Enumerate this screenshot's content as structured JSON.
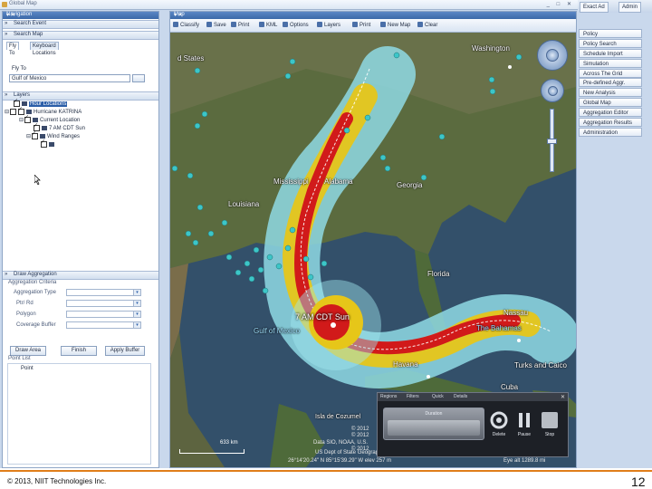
{
  "window": {
    "title": "Global Map",
    "controls": "_ □ ✕"
  },
  "navigation": {
    "header": "Navigation",
    "pin": "▾ ✕",
    "sections": {
      "search_event": "Search Event",
      "search_map": "Search Map",
      "layers": "Layers",
      "draw_aggregation": "Draw Aggregation"
    },
    "tabs": [
      "Fly To",
      "Keyboard Locations"
    ],
    "fly_to_label": "Fly To",
    "fly_to_value": "Gulf of Mexico",
    "layer_tree": [
      {
        "label": "Hour Locations",
        "selected": true
      },
      {
        "label": "Hurricane KATRINA",
        "selected": false
      },
      {
        "label": "Current Location",
        "selected": false
      },
      {
        "label": "7 AM CDT Sun",
        "selected": false
      },
      {
        "label": "Wind Ranges",
        "selected": false
      },
      {
        "label": "",
        "selected": false
      }
    ],
    "aggregation": {
      "title": "Aggregation Criteria",
      "fields": [
        "Aggregation Type",
        "Ptr/ Rd",
        "Polygon",
        "Coverage Buffer"
      ],
      "buttons": [
        "Draw Area",
        "Finish",
        "Apply Buffer"
      ]
    },
    "point_list": {
      "header": "Point List",
      "item": "Point"
    }
  },
  "map": {
    "header": "Map",
    "pin": "▾ ✕",
    "toolbar": [
      "Classify",
      "Save",
      "Print",
      "KML",
      "Options",
      "Layers",
      "Print",
      "New Map",
      "Clear"
    ],
    "labels": {
      "states": "d States",
      "washington": "Washington",
      "mississippi": "Mississippi",
      "alabama": "Alabama",
      "georgia": "Georgia",
      "louisiana": "Louisiana",
      "florida": "Florida",
      "storm": "7 AM CDT Sun",
      "gulf": "Gulf of Mexico",
      "nassau": "Nassau",
      "bahamas": "The Bahamas",
      "havana": "Havana",
      "turks": "Turks and Caico",
      "cuba": "Cuba",
      "cozumel": "Isla de Cozumel"
    },
    "scale": "633 km",
    "copyright": [
      "© 2012",
      "© 2012",
      "Data SIO, NOAA, U.S.",
      "© 2012",
      "US Dept of State Geographer"
    ],
    "status": "26°14'20.24\" N   85°15'39.29\" W   elev  257 m",
    "eye_alt": "Eye alt 1289.8 mi",
    "duration_dialog": {
      "tabs": [
        "Regions",
        "Filters",
        "Quick",
        "Details"
      ],
      "close": "✕",
      "duration_label": "Duration",
      "controls": [
        "Delete",
        "Pause",
        "Stop"
      ]
    }
  },
  "right_panel": {
    "tabs": [
      "Exact Ad",
      "Admin"
    ],
    "items": [
      "Policy",
      "Policy Search",
      "Schedule Import",
      "Simulation",
      "Across The Grid",
      "Pre-defined Aggr.",
      "New Analysis",
      "Global Map",
      "Aggregation Editor",
      "Aggregation Results",
      "Administration"
    ]
  },
  "footer": {
    "copyright": "© 2013, NIIT Technologies Inc.",
    "page_number": "12"
  },
  "colors": {
    "storm_core": "#d11a1a",
    "storm_mid": "#e6c619",
    "storm_outer": "#8fd9e4",
    "marker": "#3cc6c8",
    "accent": "#3b68a8"
  }
}
